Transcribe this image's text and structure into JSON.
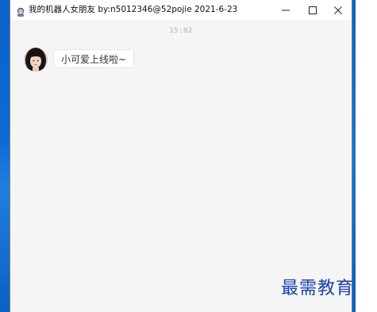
{
  "window": {
    "title": "我的机器人女朋友 by:n5012346@52pojie 2021-6-23"
  },
  "titlebar_buttons": {
    "minimize_icon": "minimize-icon",
    "maximize_icon": "maximize-icon",
    "close_icon": "close-icon"
  },
  "chat": {
    "timestamp": "15:02",
    "messages": [
      {
        "sender": "bot",
        "avatar": "avatar-girl",
        "text": "小可爱上线啦~"
      }
    ]
  },
  "watermark": {
    "text": "最需教育"
  },
  "colors": {
    "chat_background": "#f5f5f5",
    "bubble_background": "#ffffff",
    "timestamp_text": "#b3b3b3",
    "watermark_text": "#1b3faa",
    "desktop_blue": "#0b6bd6"
  }
}
